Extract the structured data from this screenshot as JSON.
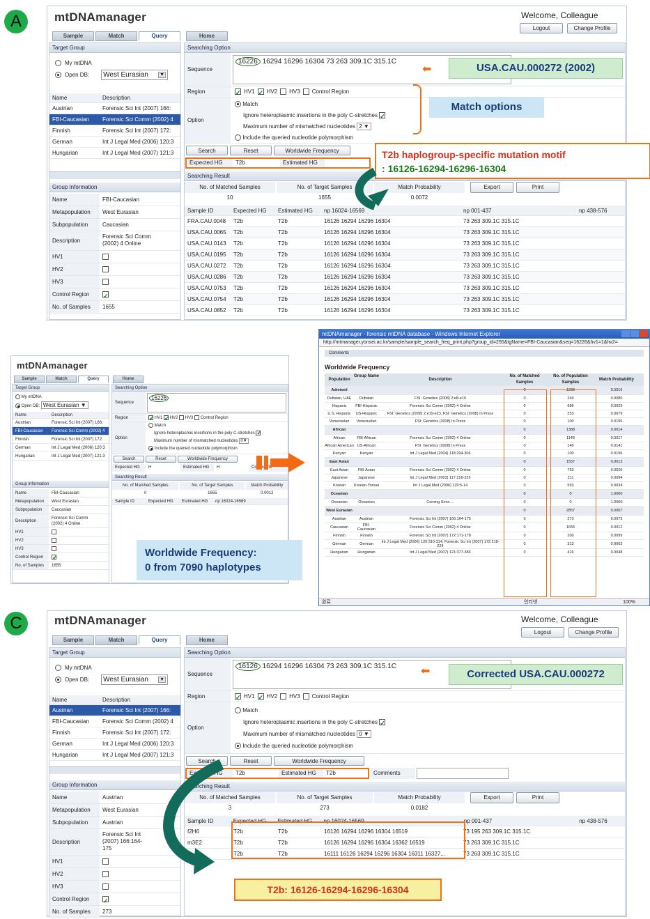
{
  "labels": {
    "a": "A",
    "b": "B",
    "c": "C"
  },
  "common": {
    "logo": "mtDNAmanager",
    "welcome": "Welcome, Colleague",
    "logout": "Logout",
    "change_profile": "Change Profile",
    "tabs": [
      "Sample",
      "Match",
      "Query",
      "Home"
    ],
    "target_group": "Target Group",
    "my_mtdna": "My mtDNA",
    "open_db": "Open DB:",
    "db_select": "West Eurasian",
    "name": "Name",
    "description": "Description",
    "group_info": "Group Information",
    "searching_option": "Searching Option",
    "sequence": "Sequence",
    "region": "Region",
    "hv1": "HV1",
    "hv2": "HV2",
    "hv3": "HV3",
    "control_region": "Control Region",
    "option": "Option",
    "match": "Match",
    "ignore": "Ignore heteroplasmic insertions in the poly C-stretches",
    "max_mismatch": "Maximum number of mismatched nucleotides",
    "include": "Include the queried nucleotide polymorphism",
    "search": "Search",
    "reset": "Reset",
    "worldwide": "Worldwide Frequency",
    "expected_hg": "Expected HG",
    "estimated_hg": "Estimated HG",
    "comments": "Comments",
    "searching_result": "Searching Result",
    "n_matched": "No. of Matched Samples",
    "n_target": "No. of Target Samples",
    "match_prob": "Match Probability",
    "export": "Export",
    "print": "Print",
    "col_sample": "Sample ID",
    "col_exp": "Expected HG",
    "col_est": "Estimated HG",
    "col_np1": "np 16024-16569",
    "col_np2": "np 001-437",
    "col_np3": "np 438-576",
    "info_keys": [
      "Name",
      "Metapopulation",
      "Subpopulation",
      "Description",
      "HV1",
      "HV2",
      "HV3",
      "Control Region",
      "No. of Samples"
    ]
  },
  "groups": [
    {
      "name": "Austrian",
      "desc": "Forensic Sci Int (2007) 166:"
    },
    {
      "name": "FBI-Caucasian",
      "desc": "Forensic Sci Comm (2002) 4"
    },
    {
      "name": "Finnish",
      "desc": "Forensic Sci Int (2007) 172:"
    },
    {
      "name": "German",
      "desc": "Int J Legal Med (2006) 120:3"
    },
    {
      "name": "Hungarian",
      "desc": "Int J Legal Med (2007) 121:3"
    }
  ],
  "panelA": {
    "seq_hl": "16226",
    "seq_rest": "16294 16296 16304 73 263 309.1C 315.1C",
    "mismatch": "2",
    "exp": "T2b",
    "est": "",
    "matched": "10",
    "target": "1655",
    "prob": "0.0072",
    "info": [
      "FBI-Caucasian",
      "West Eurasian",
      "Caucasian",
      "Forensic Sci Comm (2002) 4 Online",
      "",
      "",
      "",
      "",
      "1655"
    ],
    "rows": [
      [
        "FRA.CAU.0048",
        "T2b",
        "T2b",
        "16126 16294 16296 16304",
        "73 263 309.1C 315.1C"
      ],
      [
        "USA.CAU.0065",
        "T2b",
        "T2b",
        "16126 16294 16296 16304",
        "73 263 309.1C 315.1C"
      ],
      [
        "USA.CAU.0143",
        "T2b",
        "T2b",
        "16126 16294 16296 16304",
        "73 263 309.1C 315.1C"
      ],
      [
        "USA.CAU.0195",
        "T2b",
        "T2b",
        "16126 16294 16296 16304",
        "73 263 309.1C 315.1C"
      ],
      [
        "USA.CAU.0272",
        "T2b",
        "T2b",
        "16126 16294 16296 16304",
        "73 263 309.1C 315.1C"
      ],
      [
        "USA.CAU.0286",
        "T2b",
        "T2b",
        "16126 16294 16296 16304",
        "73 263 309.1C 315.1C"
      ],
      [
        "USA.CAU.0753",
        "T2b",
        "T2b",
        "16126 16294 16296 16304",
        "73 263 309.1C 315.1C"
      ],
      [
        "USA.CAU.0754",
        "T2b",
        "T2b",
        "16126 16294 16296 16304",
        "73 263 309.1C 315.1C"
      ],
      [
        "USA.CAU.0852",
        "T2b",
        "T2b",
        "16126 16294 16296 16304",
        "73 263 309.1C 315.1C"
      ]
    ],
    "callout_id": "USA.CAU.000272 (2002)",
    "callout_match": "Match options",
    "callout_motif1": "T2b haplogroup-specific mutation motif",
    "callout_motif2": ": 16126-16294-16296-16304"
  },
  "panelB": {
    "seq": "16226",
    "mismatch": "0",
    "exp": "H",
    "est": "H",
    "matched": "0",
    "target": "1655",
    "prob": "0.0012",
    "info": [
      "FBI-Caucasian",
      "West Eurasian",
      "Caucasian",
      "Forensic Sci Comm (2002) 4 Online",
      "",
      "",
      "",
      "",
      "1655"
    ],
    "callout1": "Worldwide Frequency:",
    "callout2": "0 from 7090 haplotypes",
    "ie_title": "mtDNAmanager - forensic mtDNA database - Windows Internet Explorer",
    "ie_url": "http://mtmanager.yonsei.ac.kr/sample/sample_search_freq_print.php?group_id=255&tgName=FBI-Caucasian&seq=16226&hv1=1&hv2=",
    "ie_comments": "Comments",
    "ie_heading": "Worldwide Frequency",
    "ie_status": "완료",
    "ie_zone": "인터넷",
    "ie_zoom": "100%",
    "ie_cols": [
      "Population",
      "Group Name",
      "Description",
      "No. of Matched Samples",
      "No. of Population Samples",
      "Match Probability"
    ],
    "ie_rows": [
      {
        "t": "g",
        "p": "Admixed",
        "m": "0",
        "n": "1288",
        "mp": "0.0016"
      },
      {
        "p": "Dubaian, UAE",
        "g": "Dubaian",
        "d": "FSI: Genetics (2008) 2:e8-e10",
        "m": "0",
        "n": "249",
        "mp": "0.0080"
      },
      {
        "p": "Hispanic",
        "g": "FBI-Hispanic",
        "d": "Forensic Sci Comm (2002) 4 Online",
        "m": "0",
        "n": "686",
        "mp": "0.0029"
      },
      {
        "p": "U.S. Hispanic",
        "g": "US-Hispanic",
        "d": "FSI: Genetics (2008) 2:e19-e23, FSI: Genetics (2008) In Press",
        "m": "0",
        "n": "253",
        "mp": "0.0079"
      },
      {
        "p": "Venezuelan",
        "g": "Venezuelan",
        "d": "FSI: Genetics (2008) In Press",
        "m": "0",
        "n": "100",
        "mp": "0.0196"
      },
      {
        "t": "g",
        "p": "African",
        "m": "0",
        "n": "1388",
        "mp": "0.0014"
      },
      {
        "p": "African",
        "g": "FBI-African",
        "d": "Forensic Sci Comm (2002) 4 Online",
        "m": "0",
        "n": "1148",
        "mp": "0.0017"
      },
      {
        "p": "African American",
        "g": "US-African",
        "d": "FSI: Genetics (2008) In Press",
        "m": "0",
        "n": "140",
        "mp": "0.0141"
      },
      {
        "p": "Kenyan",
        "g": "Kenyan",
        "d": "Int J Legal Med (2004) 118:294-306",
        "m": "0",
        "n": "100",
        "mp": "0.0196"
      },
      {
        "t": "g",
        "p": "East Asian",
        "m": "0",
        "n": "1557",
        "mp": "0.0013"
      },
      {
        "p": "East Asian",
        "g": "FBI-Asian",
        "d": "Forensic Sci Comm (2002) 4 Online",
        "m": "0",
        "n": "753",
        "mp": "0.0026"
      },
      {
        "p": "Japanese",
        "g": "Japanese",
        "d": "Int J Legal Med (2003) 117:218-225",
        "m": "0",
        "n": "211",
        "mp": "0.0094"
      },
      {
        "p": "Korean",
        "g": "Korean-Yonsei",
        "d": "Int J Legal Med (2006) 120:5-14",
        "m": "0",
        "n": "593",
        "mp": "0.0034"
      },
      {
        "t": "g",
        "p": "Oceanian",
        "m": "0",
        "n": "0",
        "mp": "1.0000"
      },
      {
        "p": "Oceanian",
        "g": "Oceanian",
        "d": "Coming Soon ...",
        "m": "0",
        "n": "0",
        "mp": "1.0000"
      },
      {
        "t": "g",
        "p": "West Eurasian",
        "m": "0",
        "n": "2857",
        "mp": "0.0007"
      },
      {
        "p": "Austrian",
        "g": "Austrian",
        "d": "Forensic Sci Int (2007) 166:164-175",
        "m": "0",
        "n": "273",
        "mp": "0.0073"
      },
      {
        "p": "Caucasian",
        "g": "FBI-Caucasian",
        "d": "Forensic Sci Comm (2002) 4 Online",
        "m": "0",
        "n": "1655",
        "mp": "0.0012"
      },
      {
        "p": "Finnish",
        "g": "Finnish",
        "d": "Forensic Sci Int (2007) 172:171-178",
        "m": "0",
        "n": "200",
        "mp": "0.0099"
      },
      {
        "p": "German",
        "g": "German",
        "d": "Int J Legal Med (2006) 120:310-314, Forensic Sci Int (2007) 172:218-224",
        "m": "0",
        "n": "313",
        "mp": "0.0063"
      },
      {
        "p": "Hungarian",
        "g": "Hungarian",
        "d": "Int J Legal Med (2007) 121:377-383",
        "m": "0",
        "n": "416",
        "mp": "0.0048"
      }
    ]
  },
  "panelC": {
    "seq_hl": "16126",
    "seq_rest": "16294 16296 16304 73 263 309.1C 315.1C",
    "mismatch": "0",
    "exp": "T2b",
    "est": "T2b",
    "matched": "3",
    "target": "273",
    "prob": "0.0182",
    "info": [
      "Austrian",
      "West Eurasian",
      "Austrian",
      "Forensic Sci Int (2007) 166:164-175",
      "",
      "",
      "",
      "",
      "273"
    ],
    "rows": [
      [
        "f2H6",
        "T2b",
        "T2b",
        "16126 16294 16296 16304 16519",
        "73 195 263 309.1C 315.1C"
      ],
      [
        "m3E2",
        "T2b",
        "T2b",
        "16126 16294 16296 16304 16362 16519",
        "73 263 309.1C 315.1C"
      ],
      [
        "",
        "T2b",
        "T2b",
        "16111 16126 16294 16296 16304 16311 16327...",
        "73 263 309.1C 315.1C"
      ]
    ],
    "callout_id": "Corrected USA.CAU.000272",
    "callout_motif": "T2b: 16126-16294-16296-16304"
  }
}
